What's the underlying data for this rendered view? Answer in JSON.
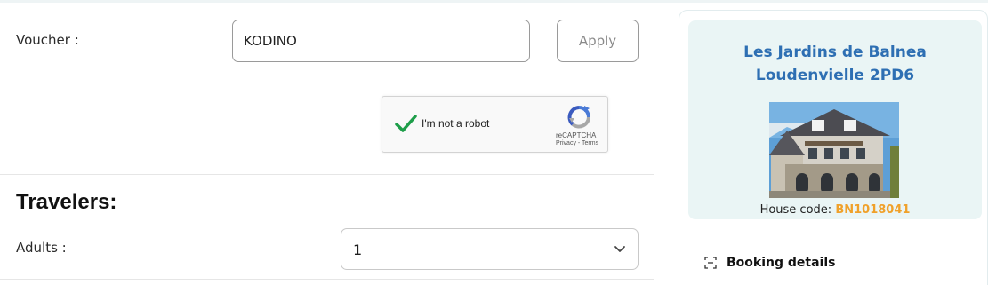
{
  "voucher": {
    "label": "Voucher :",
    "value": "KODINO",
    "apply_label": "Apply"
  },
  "captcha": {
    "label": "I'm not a robot",
    "brand": "reCAPTCHA",
    "links": "Privacy - Terms",
    "checked": true
  },
  "travelers": {
    "heading": "Travelers:",
    "adults_label": "Adults :",
    "adults_value": "1"
  },
  "hotel": {
    "name_line1": "Les Jardins de Balnea",
    "name_line2": "Loudenvielle 2PD6",
    "house_code_label": "House code:",
    "house_code": "BN1018041"
  },
  "booking": {
    "label": "Booking details"
  },
  "colors": {
    "hotel_name": "#2e6fb3",
    "house_code": "#f0a12a",
    "card_background": "#eaf5f5",
    "check": "#1e9e4a"
  }
}
